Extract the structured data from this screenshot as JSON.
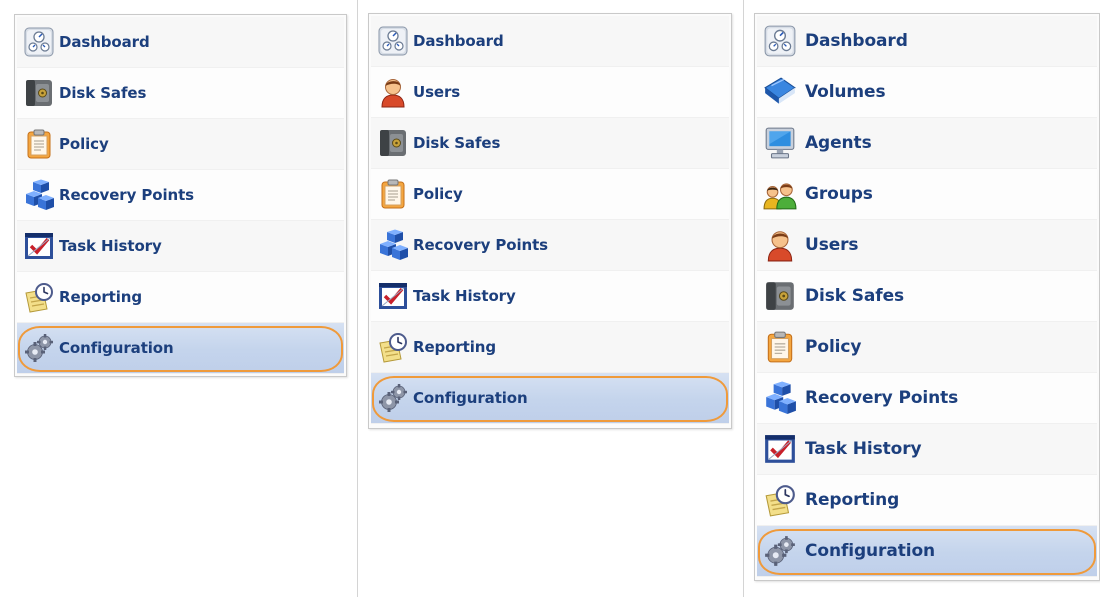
{
  "panels": [
    {
      "items": [
        {
          "label": "Dashboard",
          "icon": "dashboard-icon"
        },
        {
          "label": "Disk Safes",
          "icon": "disk-safe-icon"
        },
        {
          "label": "Policy",
          "icon": "policy-icon"
        },
        {
          "label": "Recovery Points",
          "icon": "recovery-points-icon"
        },
        {
          "label": "Task History",
          "icon": "task-history-icon"
        },
        {
          "label": "Reporting",
          "icon": "reporting-icon"
        },
        {
          "label": "Configuration",
          "icon": "configuration-icon",
          "selected": true
        }
      ]
    },
    {
      "items": [
        {
          "label": "Dashboard",
          "icon": "dashboard-icon"
        },
        {
          "label": "Users",
          "icon": "users-icon"
        },
        {
          "label": "Disk Safes",
          "icon": "disk-safe-icon"
        },
        {
          "label": "Policy",
          "icon": "policy-icon"
        },
        {
          "label": "Recovery Points",
          "icon": "recovery-points-icon"
        },
        {
          "label": "Task History",
          "icon": "task-history-icon"
        },
        {
          "label": "Reporting",
          "icon": "reporting-icon"
        },
        {
          "label": "Configuration",
          "icon": "configuration-icon",
          "selected": true
        }
      ]
    },
    {
      "items": [
        {
          "label": "Dashboard",
          "icon": "dashboard-icon"
        },
        {
          "label": "Volumes",
          "icon": "volumes-icon"
        },
        {
          "label": "Agents",
          "icon": "agents-icon"
        },
        {
          "label": "Groups",
          "icon": "groups-icon"
        },
        {
          "label": "Users",
          "icon": "users-icon"
        },
        {
          "label": "Disk Safes",
          "icon": "disk-safe-icon"
        },
        {
          "label": "Policy",
          "icon": "policy-icon"
        },
        {
          "label": "Recovery Points",
          "icon": "recovery-points-icon"
        },
        {
          "label": "Task History",
          "icon": "task-history-icon"
        },
        {
          "label": "Reporting",
          "icon": "reporting-icon"
        },
        {
          "label": "Configuration",
          "icon": "configuration-icon",
          "selected": true
        }
      ]
    }
  ],
  "colors": {
    "label_text": "#1c3f7d",
    "selected_highlight": "#c4d4ec",
    "selected_ring": "#ef9a3b"
  }
}
